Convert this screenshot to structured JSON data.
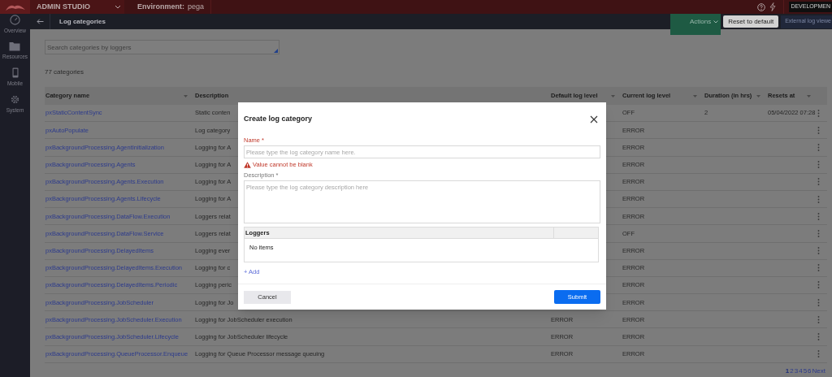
{
  "header": {
    "app_title": "ADMIN STUDIO",
    "environment_label": "Environment:",
    "environment_value": "pega",
    "badge": "DEVELOPMEN"
  },
  "sidebar": {
    "items": [
      {
        "label": "Overview",
        "kind": "gauge"
      },
      {
        "label": "Resources",
        "kind": "folder"
      },
      {
        "label": "Mobile",
        "kind": "phone"
      },
      {
        "label": "System",
        "kind": "gear"
      }
    ]
  },
  "toolbar": {
    "title": "Log categories",
    "actions": "Actions",
    "reset": "Reset to default",
    "external": "External log viewe"
  },
  "search": {
    "placeholder": "Search categories by loggers"
  },
  "count": "77 categories",
  "table": {
    "columns": [
      {
        "label": "Category name",
        "sortable": true
      },
      {
        "label": "Description",
        "sortable": false
      },
      {
        "label": "Default log level",
        "sortable": true
      },
      {
        "label": "Current log level",
        "sortable": true
      },
      {
        "label": "Duration (in hrs)",
        "sortable": true
      },
      {
        "label": "Resets at",
        "sortable": true
      }
    ],
    "rows": [
      {
        "name": "pxStaticContentSync",
        "description": "Static conten",
        "current_level": "OFF",
        "duration": "2",
        "resets_at": "05/04/2022 07:28"
      },
      {
        "name": "pxAutoPopulate",
        "description": "Log category",
        "current_level": "ERROR"
      },
      {
        "name": "pxBackgroundProcessing.AgentInitialization",
        "description": "Logging for A",
        "current_level": "ERROR"
      },
      {
        "name": "pxBackgroundProcessing.Agents",
        "description": "Logging for A",
        "current_level": "ERROR"
      },
      {
        "name": "pxBackgroundProcessing.Agents.Execution",
        "description": "Logging for A",
        "current_level": "ERROR"
      },
      {
        "name": "pxBackgroundProcessing.Agents.Lifecycle",
        "description": "Logging for A",
        "current_level": "ERROR"
      },
      {
        "name": "pxBackgroundProcessing.DataFlow.Execution",
        "description": "Loggers relat",
        "current_level": "ERROR"
      },
      {
        "name": "pxBackgroundProcessing.DataFlow.Service",
        "description": "Loggers relat",
        "current_level": "OFF"
      },
      {
        "name": "pxBackgroundProcessing.DelayedItems",
        "description": "Logging ever",
        "current_level": "ERROR"
      },
      {
        "name": "pxBackgroundProcessing.DelayedItems.Execution",
        "description": "Logging for c",
        "current_level": "ERROR"
      },
      {
        "name": "pxBackgroundProcessing.DelayedItems.Periodic",
        "description": "Logging peric",
        "current_level": "ERROR"
      },
      {
        "name": "pxBackgroundProcessing.JobScheduler",
        "description": "Logging for Jo",
        "current_level": "ERROR"
      },
      {
        "name": "pxBackgroundProcessing.JobScheduler.Execution",
        "description": "Logging for JobScheduler execution",
        "default_level": "ERROR",
        "current_level": "ERROR"
      },
      {
        "name": "pxBackgroundProcessing.JobScheduler.Lifecycle",
        "description": "Logging for JobScheduler lifecycle",
        "default_level": "ERROR",
        "current_level": "ERROR"
      },
      {
        "name": "pxBackgroundProcessing.QueueProcessor.Enqueue",
        "description": "Logging for Queue Processor message queuing",
        "default_level": "ERROR",
        "current_level": "ERROR"
      }
    ]
  },
  "pagination": {
    "pages": [
      {
        "label": "1",
        "selected": true
      },
      {
        "label": "2",
        "selected": false
      },
      {
        "label": "3",
        "selected": false
      },
      {
        "label": "4",
        "selected": false
      },
      {
        "label": "5",
        "selected": false
      },
      {
        "label": "6",
        "selected": false
      }
    ],
    "next": "Next"
  },
  "dialog": {
    "title": "Create log category",
    "name_label": "Name",
    "name_required": "*",
    "name_placeholder": "Please type the log category name here.",
    "name_error": "Value cannot be blank",
    "description_label": "Description",
    "description_required": "*",
    "description_placeholder": "Please type the log category description here",
    "loggers_header": "Loggers",
    "loggers_empty": "No items",
    "add": "+ Add",
    "cancel": "Cancel",
    "submit": "Submit"
  }
}
